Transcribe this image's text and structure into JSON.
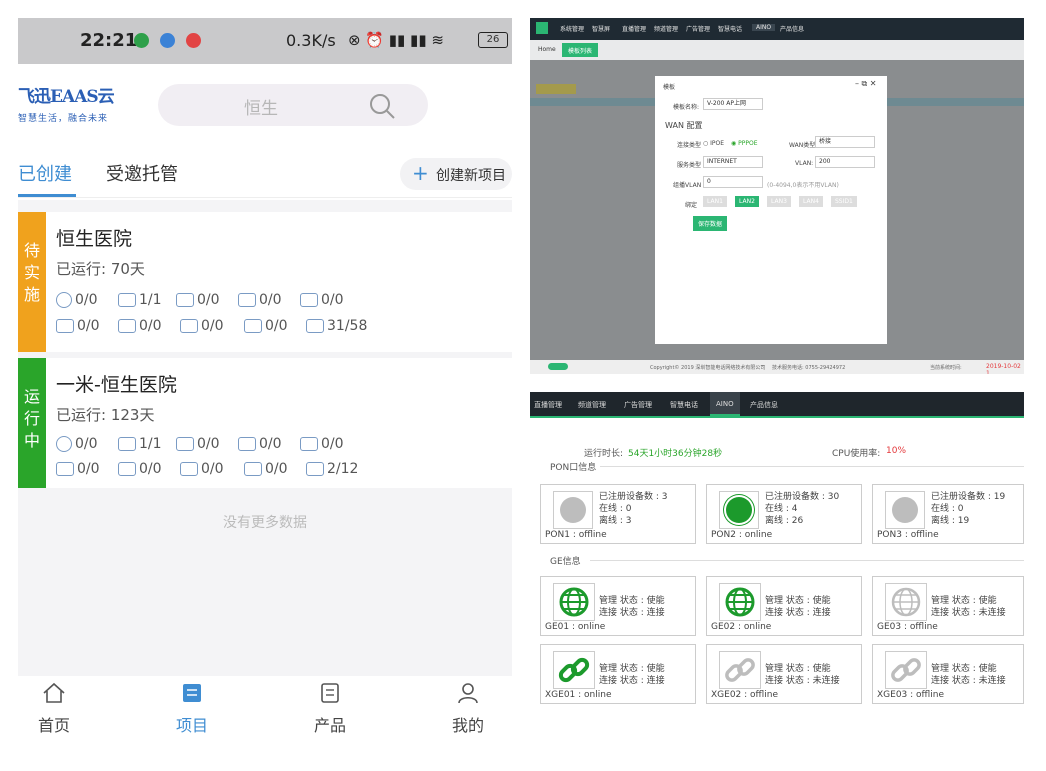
{
  "phone": {
    "status": {
      "time": "22:21",
      "net": "0.3K/s",
      "battery": "26"
    },
    "logo": {
      "title": "飞迅EAAS云",
      "slogan": "智慧生活，融合未来"
    },
    "search": {
      "placeholder": "恒生"
    },
    "tabs": [
      {
        "label": "已创建"
      },
      {
        "label": "受邀托管"
      }
    ],
    "create_label": "创建新项目",
    "projects": [
      {
        "badge": "待实施",
        "name": "恒生医院",
        "run": "已运行: 70天",
        "row1": [
          "0/0",
          "1/1",
          "0/0",
          "0/0",
          "0/0"
        ],
        "row2": [
          "0/0",
          "0/0",
          "0/0",
          "0/0",
          "31/58"
        ]
      },
      {
        "badge": "运行中",
        "name": "一米-恒生医院",
        "run": "已运行: 123天",
        "row1": [
          "0/0",
          "1/1",
          "0/0",
          "0/0",
          "0/0"
        ],
        "row2": [
          "0/0",
          "0/0",
          "0/0",
          "0/0",
          "2/12"
        ]
      }
    ],
    "nomore": "没有更多数据",
    "nav": [
      {
        "label": "首页"
      },
      {
        "label": "项目"
      },
      {
        "label": "产品"
      },
      {
        "label": "我的"
      }
    ]
  },
  "admin": {
    "menu": [
      "系统管理",
      "智慧屏",
      "直播管理",
      "频道管理",
      "广告管理",
      "智慧电话",
      "AINO",
      "产品信息"
    ],
    "tabs": [
      "Home",
      "模板列表"
    ],
    "dialog": {
      "title": "模板",
      "name_label": "模板名称:",
      "name_value": "V-200 AP上网",
      "section": "WAN 配置",
      "conn_label": "连接类型",
      "ipoe": "IPOE",
      "pppoe": "PPPOE",
      "wan_type_label": "WAN类型",
      "wan_type_value": "桥接",
      "service_label": "服务类型",
      "service_value": "INTERNET",
      "vlan_label": "VLAN:",
      "vlan_value": "200",
      "mvlan_label": "组播VLAN",
      "mvlan_value": "0",
      "mvlan_hint": "(0-4094,0表示不用VLAN)",
      "bind_label": "绑定",
      "ports": [
        "LAN1",
        "LAN2",
        "LAN3",
        "LAN4",
        "SSID1"
      ],
      "save": "保存数据"
    },
    "footer": {
      "copyright": "Copyright© 2019 深圳智能电话网络技术有限公司",
      "phone": "技术服务电话: 0755-29424972",
      "time_label": "当前系统时间:",
      "time": "2019-10-02 1"
    }
  },
  "panel": {
    "menu": [
      "直播管理",
      "频道管理",
      "广告管理",
      "智慧电话",
      "AINO",
      "产品信息"
    ],
    "uptime_label": "运行时长:",
    "uptime": "54天1小时36分钟28秒",
    "cpu_label": "CPU使用率:",
    "cpu": "10%",
    "pon_title": "PON口信息",
    "pons": [
      {
        "reg": "已注册设备数 : 3",
        "on": "在线 : 0",
        "off": "离线 : 3",
        "name": "PON1 : offline",
        "state": "offline"
      },
      {
        "reg": "已注册设备数 : 30",
        "on": "在线 : 4",
        "off": "离线 : 26",
        "name": "PON2 : online",
        "state": "online"
      },
      {
        "reg": "已注册设备数 : 19",
        "on": "在线 : 0",
        "off": "离线 : 19",
        "name": "PON3 : offline",
        "state": "offline"
      }
    ],
    "ge_title": "GE信息",
    "ges": [
      {
        "mgmt": "管理 状态 : 使能",
        "conn": "连接 状态 : 连接",
        "name": "GE01 : online",
        "state": "online"
      },
      {
        "mgmt": "管理 状态 : 使能",
        "conn": "连接 状态 : 连接",
        "name": "GE02 : online",
        "state": "online"
      },
      {
        "mgmt": "管理 状态 : 使能",
        "conn": "连接 状态 : 未连接",
        "name": "GE03 : offline",
        "state": "offline"
      }
    ],
    "xges": [
      {
        "mgmt": "管理 状态 : 使能",
        "conn": "连接 状态 : 连接",
        "name": "XGE01 : online",
        "state": "online"
      },
      {
        "mgmt": "管理 状态 : 使能",
        "conn": "连接 状态 : 未连接",
        "name": "XGE02 : offline",
        "state": "offline"
      },
      {
        "mgmt": "管理 状态 : 使能",
        "conn": "连接 状态 : 未连接",
        "name": "XGE03 : offline",
        "state": "offline"
      }
    ]
  },
  "colors": {
    "accent": "#3f8dd2",
    "pending": "#f0a21d",
    "running": "#2aa52a",
    "online": "#1c9a2c",
    "offline": "#bdbdbd",
    "cpu": "#e4393c"
  }
}
